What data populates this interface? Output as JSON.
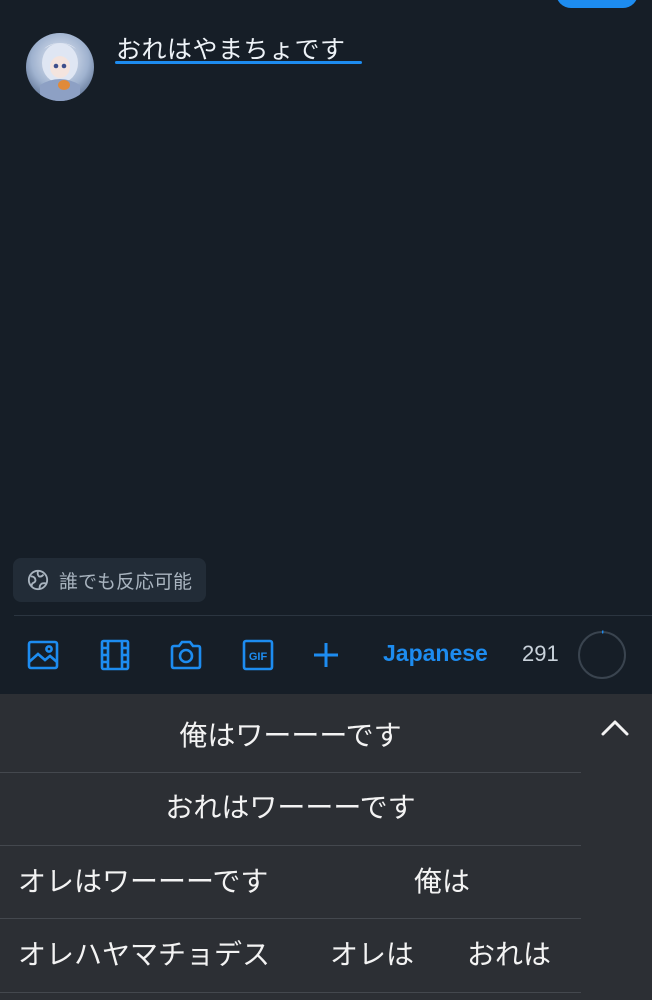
{
  "compose": {
    "text": "おれはやまちょです"
  },
  "reply_setting": {
    "label": "誰でも反応可能"
  },
  "toolbar": {
    "language": "Japanese",
    "remaining_chars": "291"
  },
  "keyboard": {
    "candidates": [
      {
        "text": "俺はワーーーです"
      },
      {
        "text": "おれはワーーーです"
      },
      {
        "text": "オレはワーーーです"
      },
      {
        "text": "俺は"
      },
      {
        "text": "オレハヤマチョデス"
      },
      {
        "text": "オレは"
      },
      {
        "text": "おれは"
      }
    ]
  },
  "colors": {
    "accent": "#1d8cf0",
    "background": "#161e27",
    "keyboard": "#2c2f34"
  }
}
